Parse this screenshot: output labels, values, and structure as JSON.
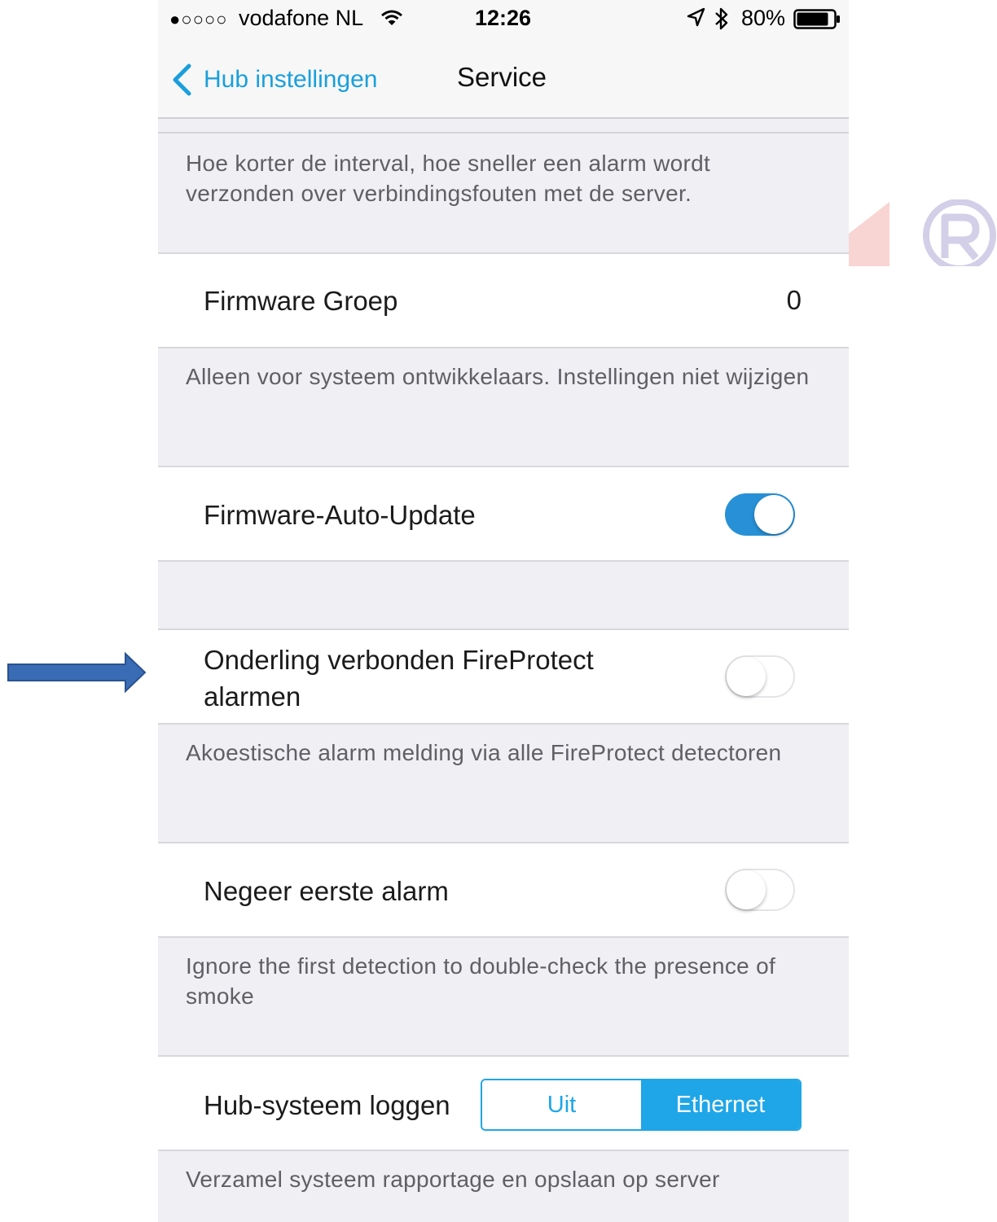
{
  "status_bar": {
    "signal": "●○○○○",
    "carrier": "vodafone NL",
    "time": "12:26",
    "battery": "80%",
    "icons": [
      "wifi-icon",
      "location-arrow-icon",
      "bluetooth-icon",
      "battery-icon"
    ]
  },
  "nav": {
    "back_label": "Hub instellingen",
    "title": "Service"
  },
  "sections": {
    "interval_footer": "Hoe korter de interval, hoe sneller een alarm wordt verzonden over verbindingsfouten met de server.",
    "firmware_group": {
      "label": "Firmware Groep",
      "value": "0"
    },
    "firmware_group_footer": "Alleen voor systeem ontwikkelaars. Instellingen niet wijzigen",
    "firmware_auto_update": {
      "label": "Firmware-Auto-Update",
      "enabled": true
    },
    "interconnected": {
      "label": "Onderling verbonden FireProtect alarmen",
      "enabled": false
    },
    "interconnected_footer": "Akoestische alarm melding via alle FireProtect detectoren",
    "ignore_first": {
      "label": "Negeer eerste alarm",
      "enabled": false
    },
    "ignore_first_footer": "Ignore the first detection to double-check the presence of smoke",
    "hub_logging": {
      "label": "Hub-systeem loggen",
      "options": [
        "Uit",
        "Ethernet"
      ],
      "selected": "Ethernet"
    },
    "hub_logging_footer": "Verzamel systeem rapportage en opslaan op server"
  },
  "colors": {
    "accent": "#1fa6e8",
    "toggle_on": "#2790d6",
    "group_bg": "#efeff4",
    "annotation_arrow": "#3a6cb5"
  }
}
